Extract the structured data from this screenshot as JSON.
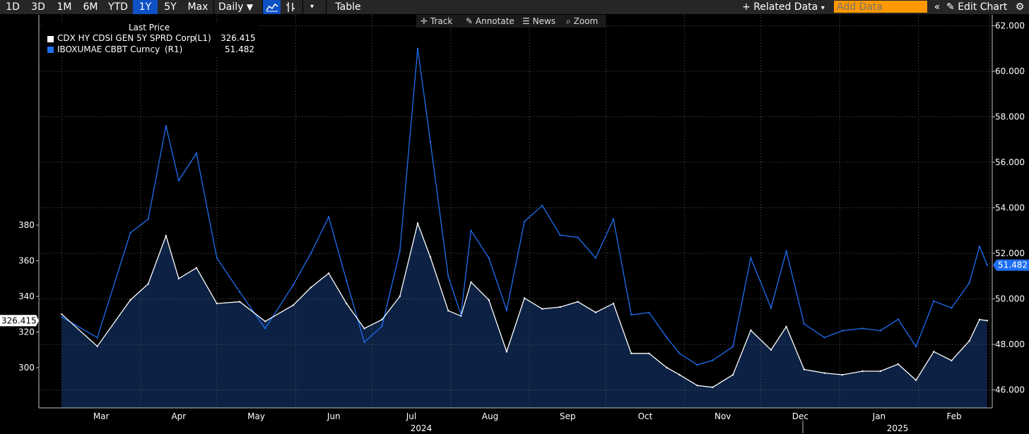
{
  "toolbar": {
    "periods": [
      "1D",
      "3D",
      "1M",
      "6M",
      "YTD",
      "1Y",
      "5Y",
      "Max"
    ],
    "active_period": "1Y",
    "frequency": "Daily",
    "table_label": "Table",
    "related_data": "Related Data",
    "add_data_placeholder": "Add Data",
    "edit_chart": "Edit Chart"
  },
  "subtoolbar": {
    "track": "Track",
    "annotate": "Annotate",
    "news": "News",
    "zoom": "Zoom"
  },
  "legend": {
    "title": "Last Price",
    "rows": [
      {
        "name": "CDX HY CDSI GEN 5Y SPRD Corp",
        "axis": "(L1)",
        "value": "326.415",
        "color": "#ffffff"
      },
      {
        "name": "IBOXUMAE CBBT Curncy",
        "axis": "(R1)",
        "value": "51.482",
        "color": "#1e6ff0"
      }
    ]
  },
  "colors": {
    "background": "#000000",
    "area_fill": "#0c2143",
    "cdx_line": "#ffffff",
    "ibox_line": "#1e6ff0",
    "grid": "#5a5a5a"
  },
  "chart_data": {
    "type": "line",
    "x": [
      "2024-03-01",
      "2024-03-15",
      "2024-03-28",
      "2024-04-04",
      "2024-04-11",
      "2024-04-16",
      "2024-04-23",
      "2024-05-01",
      "2024-05-10",
      "2024-05-20",
      "2024-05-31",
      "2024-06-07",
      "2024-06-14",
      "2024-06-21",
      "2024-06-28",
      "2024-07-05",
      "2024-07-12",
      "2024-07-19",
      "2024-07-24",
      "2024-07-31",
      "2024-08-05",
      "2024-08-09",
      "2024-08-16",
      "2024-08-23",
      "2024-08-30",
      "2024-09-06",
      "2024-09-13",
      "2024-09-20",
      "2024-09-27",
      "2024-10-04",
      "2024-10-11",
      "2024-10-18",
      "2024-10-25",
      "2024-10-30",
      "2024-11-06",
      "2024-11-12",
      "2024-11-20",
      "2024-11-27",
      "2024-12-05",
      "2024-12-11",
      "2024-12-18",
      "2024-12-26",
      "2025-01-02",
      "2025-01-10",
      "2025-01-17",
      "2025-01-24",
      "2025-01-31",
      "2025-02-07",
      "2025-02-14",
      "2025-02-21",
      "2025-02-25",
      "2025-02-28"
    ],
    "series": [
      {
        "name": "CDX HY CDSI GEN 5Y SPRD Corp",
        "axis": "left",
        "values": [
          330,
          312,
          338,
          347,
          374,
          350,
          356,
          336,
          337,
          326,
          335,
          345,
          353,
          336,
          322,
          327,
          340,
          381,
          362,
          332,
          329,
          348,
          338,
          309,
          339,
          333,
          334,
          337,
          331,
          336,
          308,
          308,
          300,
          296,
          290,
          289,
          296,
          321,
          310,
          323,
          299,
          297,
          296,
          298,
          298,
          302,
          293,
          309,
          304,
          315,
          327,
          326.415
        ]
      },
      {
        "name": "IBOXUMAE CBBT Curncy",
        "axis": "right",
        "values": [
          49.2,
          48.3,
          52.9,
          53.5,
          57.6,
          55.2,
          56.4,
          51.8,
          50.3,
          48.7,
          50.6,
          52.0,
          53.6,
          50.8,
          48.1,
          48.8,
          52.1,
          61.0,
          56.9,
          51.0,
          49.3,
          53.0,
          51.8,
          49.5,
          53.4,
          54.1,
          52.8,
          52.7,
          51.8,
          53.5,
          49.3,
          49.4,
          48.3,
          47.6,
          47.1,
          47.3,
          47.9,
          51.8,
          49.6,
          52.1,
          48.9,
          48.3,
          48.6,
          48.7,
          48.6,
          49.1,
          47.9,
          49.9,
          49.6,
          50.7,
          52.3,
          51.482
        ]
      }
    ],
    "x_month_labels": [
      "Mar",
      "Apr",
      "May",
      "Jun",
      "Jul",
      "Aug",
      "Sep",
      "Oct",
      "Nov",
      "Dec",
      "Jan",
      "Feb"
    ],
    "year_labels": [
      "2024",
      "2025"
    ],
    "left_axis": {
      "ticks": [
        "300",
        "320",
        "340",
        "360",
        "380"
      ],
      "last_value_label": "326.415",
      "range": [
        283,
        393
      ]
    },
    "right_axis": {
      "ticks": [
        "46.000",
        "48.000",
        "50.000",
        "52.000",
        "54.000",
        "56.000",
        "58.000",
        "60.000",
        "62.000"
      ],
      "last_value_label": "51.482",
      "range": [
        45.5,
        62.4
      ]
    },
    "grid": true,
    "legend_position": "top-left"
  }
}
